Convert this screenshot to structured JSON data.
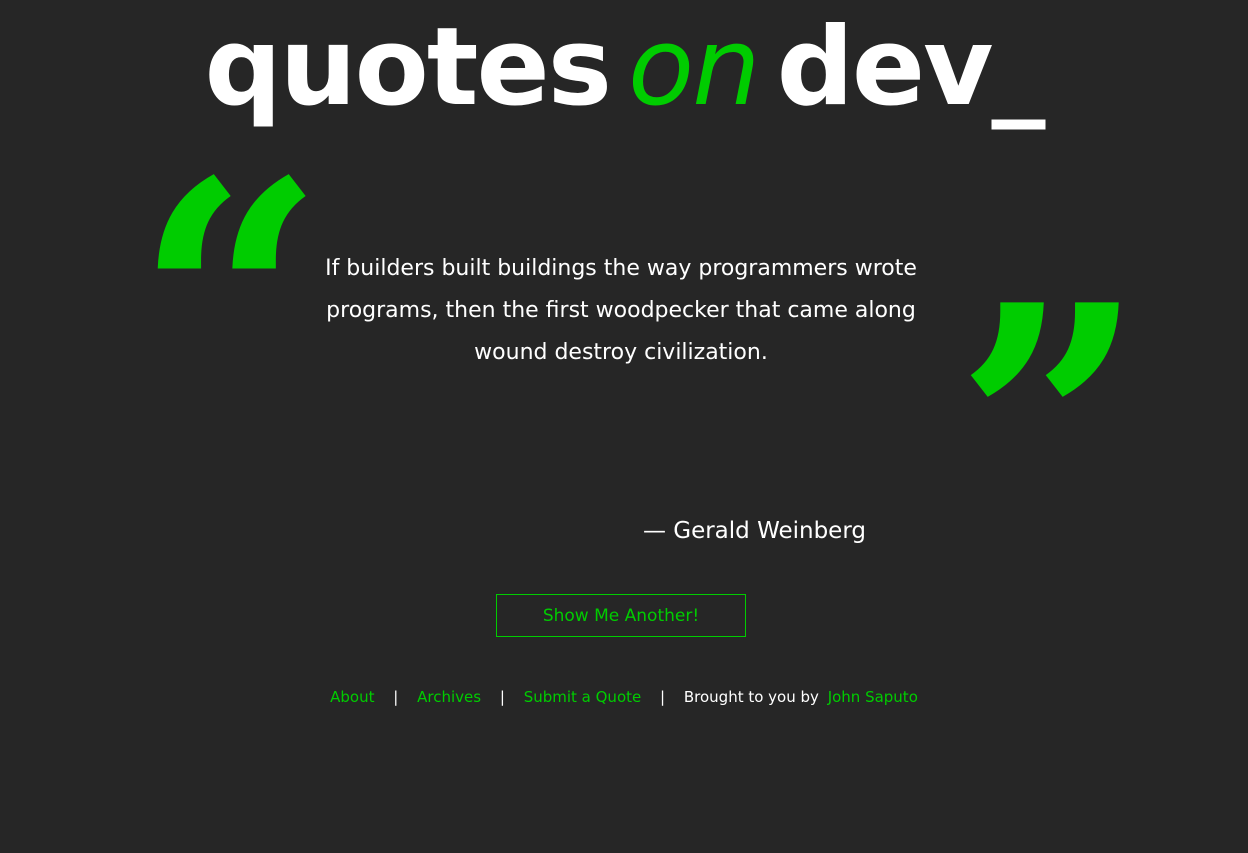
{
  "logo": {
    "word1": "quotes",
    "accent": "on",
    "word2": "dev_"
  },
  "quote": {
    "open_mark": "“",
    "close_mark": "”",
    "text": "If builders built buildings the way programmers wrote programs, then the first woodpecker that came along wound destroy civilization.",
    "author": "— Gerald Weinberg"
  },
  "actions": {
    "show_another_label": "Show Me Another!"
  },
  "footer": {
    "links": {
      "about": "About",
      "archives": "Archives",
      "submit": "Submit a Quote"
    },
    "separator": "|",
    "credit_prefix": "Brought to you by",
    "credit_name": "John Saputo"
  },
  "colors": {
    "background": "#262626",
    "accent": "#00cc00",
    "text": "#ffffff"
  }
}
